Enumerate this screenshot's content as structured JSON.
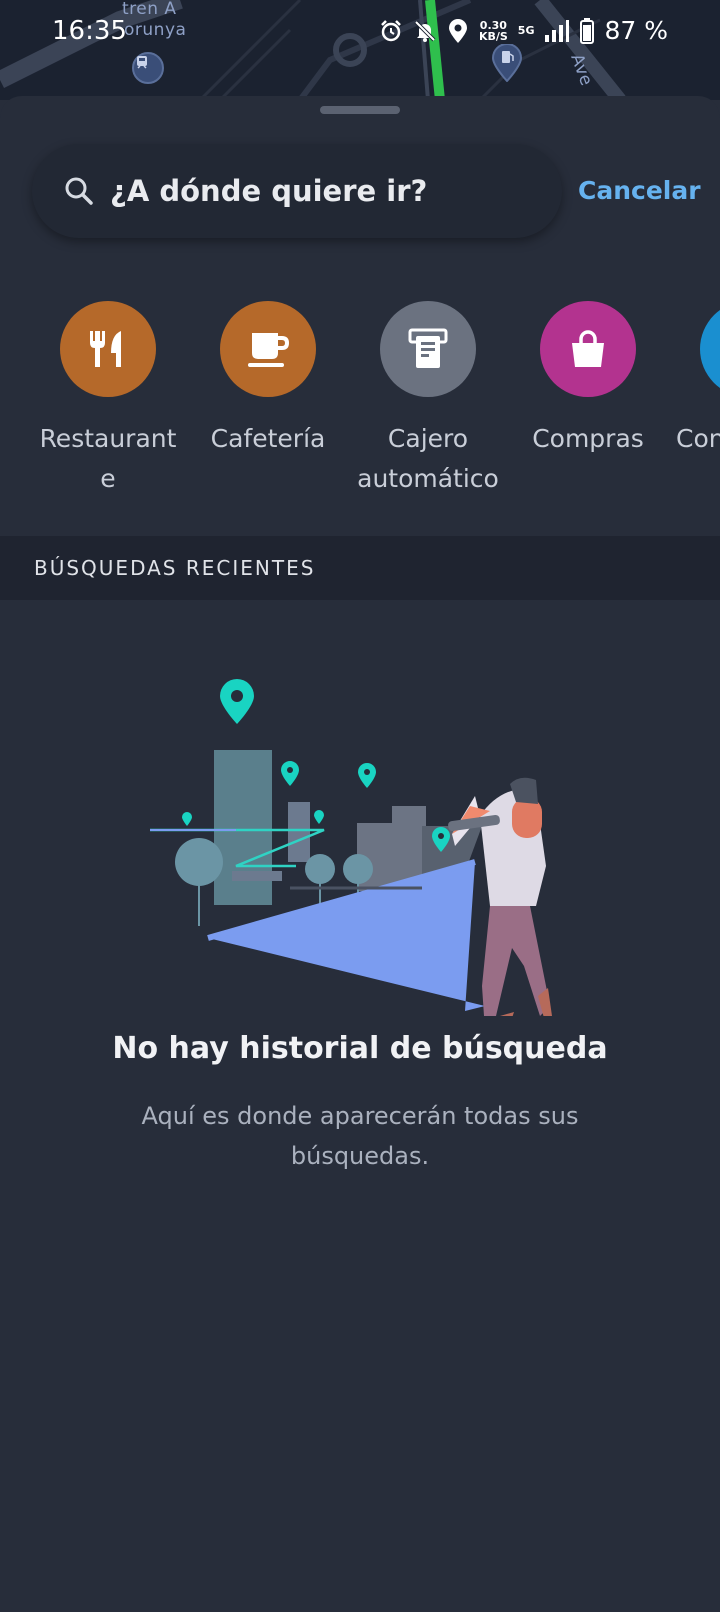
{
  "status_bar": {
    "time": "16:35",
    "net_speed": "0.30",
    "net_unit": "KB/S",
    "network_type": "5G",
    "battery": "87 %"
  },
  "map": {
    "label_1": "tren A",
    "label_2": "orunya",
    "label_3": "Ave"
  },
  "search": {
    "placeholder": "¿A dónde quiere ir?",
    "cancel_label": "Cancelar"
  },
  "categories": [
    {
      "label": "Restaurant e",
      "line1": "Restaurant",
      "line2": "e",
      "icon": "fork-knife-icon",
      "color": "#b5692a"
    },
    {
      "label": "Cafetería",
      "line1": "Cafetería",
      "line2": "",
      "icon": "coffee-cup-icon",
      "color": "#b5692a"
    },
    {
      "label": "Cajero automático",
      "line1": "Cajero",
      "line2": "automático",
      "icon": "atm-icon",
      "color": "#6b7280"
    },
    {
      "label": "Compras",
      "line1": "Compras",
      "line2": "",
      "icon": "shopping-bag-icon",
      "color": "#b3338f"
    },
    {
      "label": "Con",
      "line1": "Con",
      "line2": "",
      "icon": "partial-category-icon",
      "color": "#1a8fd0"
    }
  ],
  "recent": {
    "header": "BÚSQUEDAS RECIENTES",
    "empty_title": "No hay historial de búsqueda",
    "empty_subtitle": "Aquí es donde aparecerán todas sus búsquedas."
  },
  "colors": {
    "background": "#272d3a",
    "accent": "#66b2ef",
    "teal_pin": "#19d4c2"
  }
}
